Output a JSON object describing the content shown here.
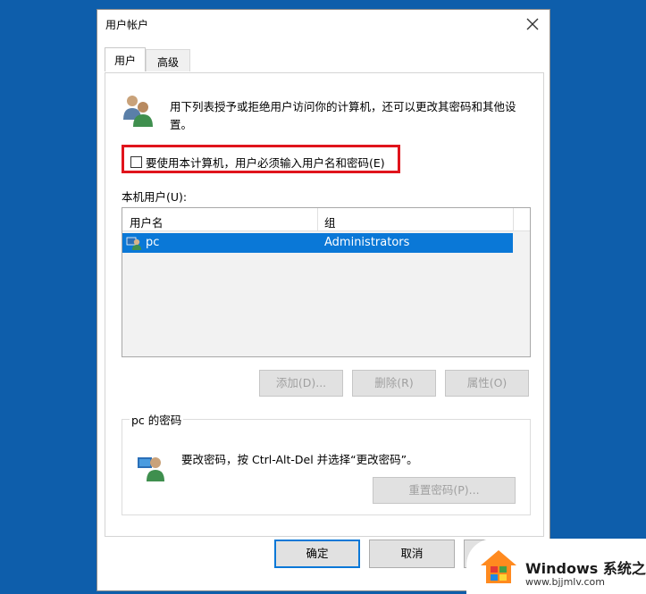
{
  "window": {
    "title": "用户帐户"
  },
  "tabs": [
    {
      "label": "用户",
      "active": true
    },
    {
      "label": "高级",
      "active": false
    }
  ],
  "intro": {
    "text": "用下列表授予或拒绝用户访问你的计算机，还可以更改其密码和其他设置。"
  },
  "require_password": {
    "label": "要使用本计算机，用户必须输入用户名和密码(E)",
    "checked": false,
    "highlight_color": "#e0141c"
  },
  "users_section": {
    "label": "本机用户(U):",
    "columns": [
      "用户名",
      "组"
    ],
    "rows": [
      {
        "username": "pc",
        "group": "Administrators",
        "selected": true
      }
    ]
  },
  "user_buttons": {
    "add": "添加(D)...",
    "remove": "删除(R)",
    "properties": "属性(O)"
  },
  "password_group": {
    "title": "pc 的密码",
    "text": "要改密码，按 Ctrl-Alt-Del 并选择“更改密码”。",
    "reset_button": "重置密码(P)..."
  },
  "footer": {
    "ok": "确定",
    "cancel": "取消",
    "apply": ""
  },
  "watermark": {
    "title": "Windows 系统之家",
    "url": "www.bjjmlv.com"
  },
  "colors": {
    "desktop": "#0e5eab",
    "selection": "#0a78d7",
    "highlight": "#e0141c"
  }
}
